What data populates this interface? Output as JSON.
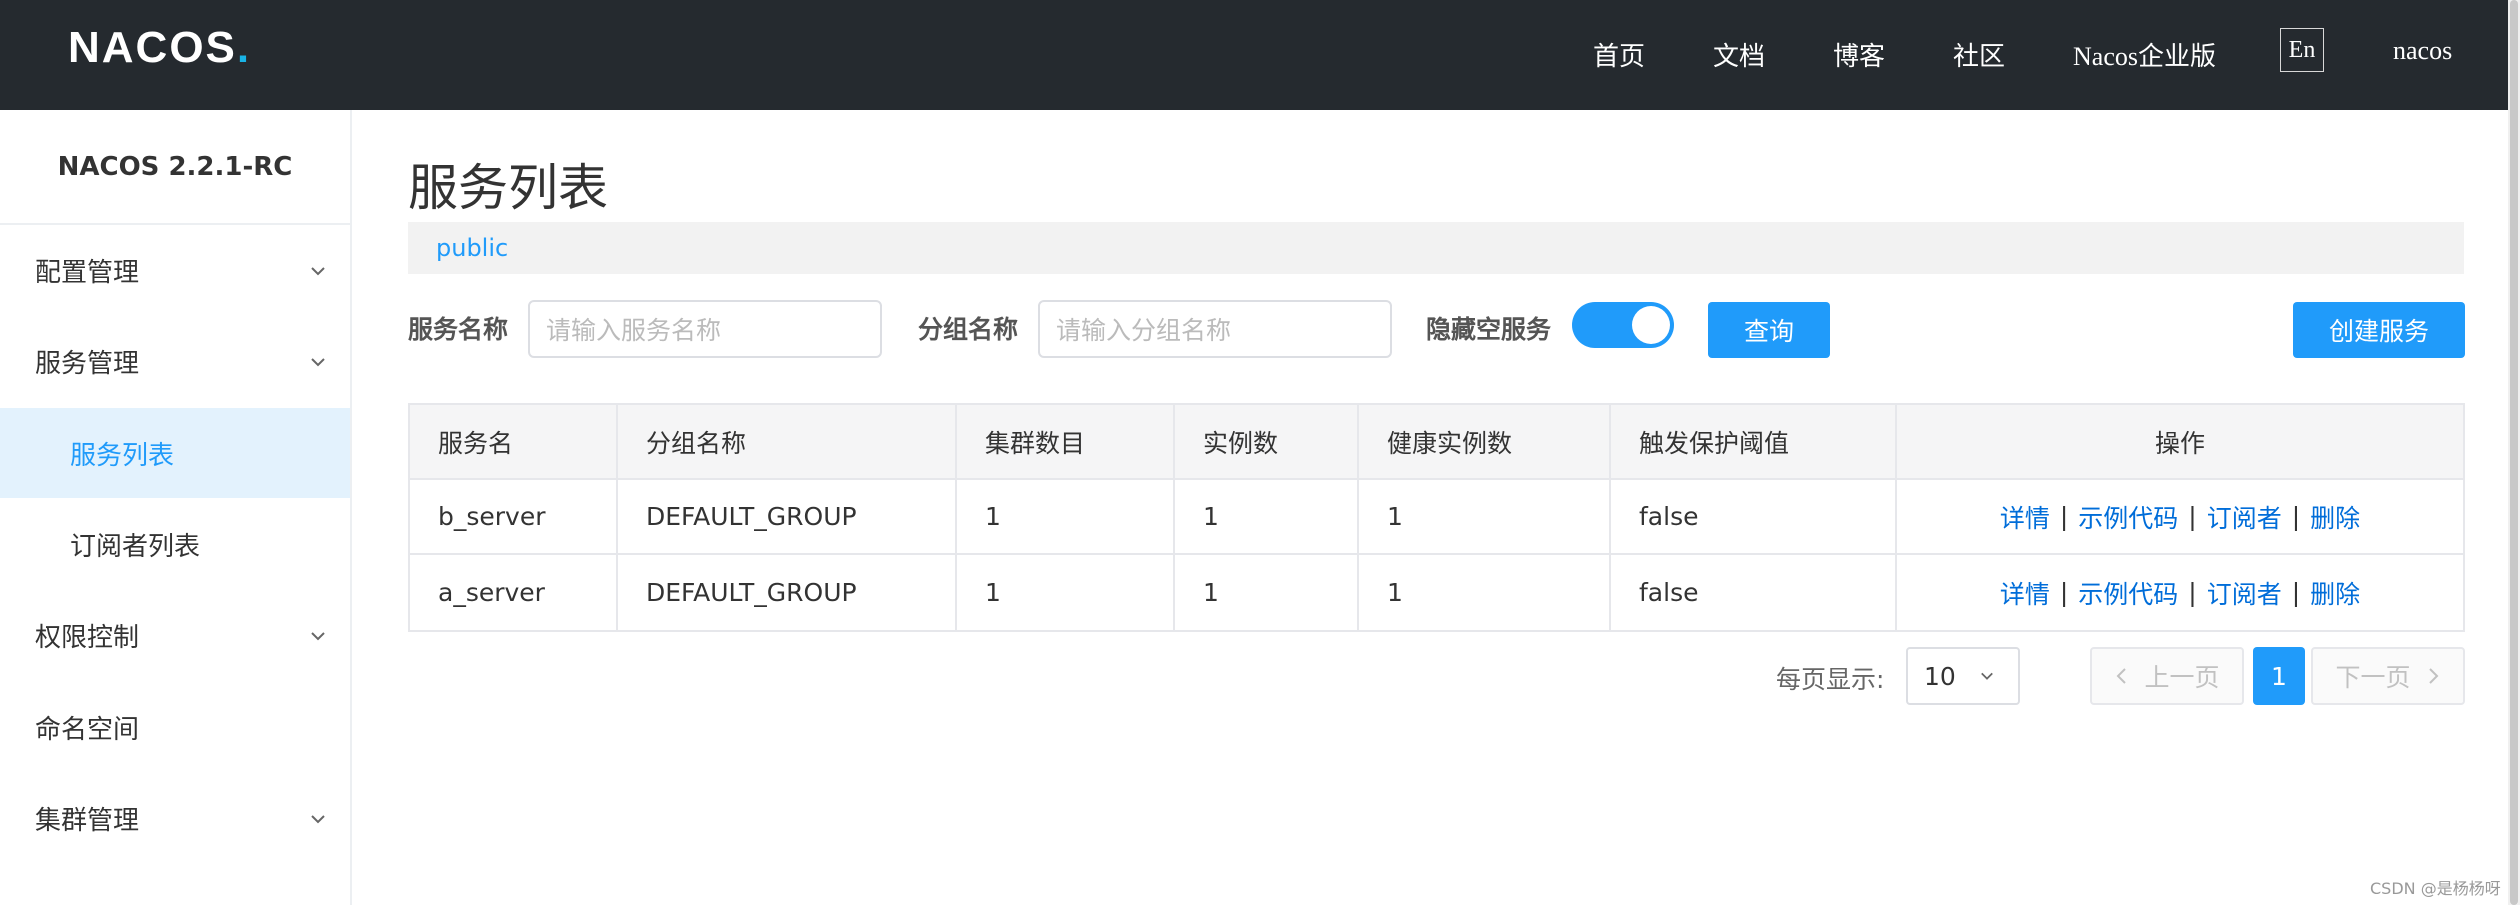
{
  "header": {
    "logo_text": "NACOS",
    "logo_dot": ".",
    "nav": [
      "首页",
      "文档",
      "博客",
      "社区",
      "Nacos企业版"
    ],
    "lang_button": "En",
    "user": "nacos"
  },
  "sidebar": {
    "version": "NACOS 2.2.1-RC",
    "items": [
      {
        "label": "配置管理",
        "expandable": true
      },
      {
        "label": "服务管理",
        "expandable": true
      },
      {
        "label": "服务列表",
        "sub": true,
        "active": true
      },
      {
        "label": "订阅者列表",
        "sub": true
      },
      {
        "label": "权限控制",
        "expandable": true
      },
      {
        "label": "命名空间"
      },
      {
        "label": "集群管理",
        "expandable": true
      }
    ]
  },
  "main": {
    "title": "服务列表",
    "namespace": "public",
    "filters": {
      "service_name_label": "服务名称",
      "service_name_placeholder": "请输入服务名称",
      "group_name_label": "分组名称",
      "group_name_placeholder": "请输入分组名称",
      "hide_empty_label": "隐藏空服务",
      "hide_empty_on": true,
      "query_button": "查询",
      "create_button": "创建服务"
    },
    "table": {
      "columns": [
        "服务名",
        "分组名称",
        "集群数目",
        "实例数",
        "健康实例数",
        "触发保护阈值",
        "操作"
      ],
      "rows": [
        {
          "name": "b_server",
          "group": "DEFAULT_GROUP",
          "clusters": "1",
          "instances": "1",
          "healthy": "1",
          "threshold": "false"
        },
        {
          "name": "a_server",
          "group": "DEFAULT_GROUP",
          "clusters": "1",
          "instances": "1",
          "healthy": "1",
          "threshold": "false"
        }
      ],
      "actions": [
        "详情",
        "示例代码",
        "订阅者",
        "删除"
      ],
      "action_separator": "|"
    },
    "pagination": {
      "page_size_label": "每页显示:",
      "page_size": "10",
      "prev": "上一页",
      "current": "1",
      "next": "下一页"
    }
  },
  "watermark": "CSDN @是杨杨呀",
  "colors": {
    "header_bg": "#252a2f",
    "primary": "#209bfa",
    "link": "#006dd9",
    "active_bg": "#e3f2fd"
  }
}
